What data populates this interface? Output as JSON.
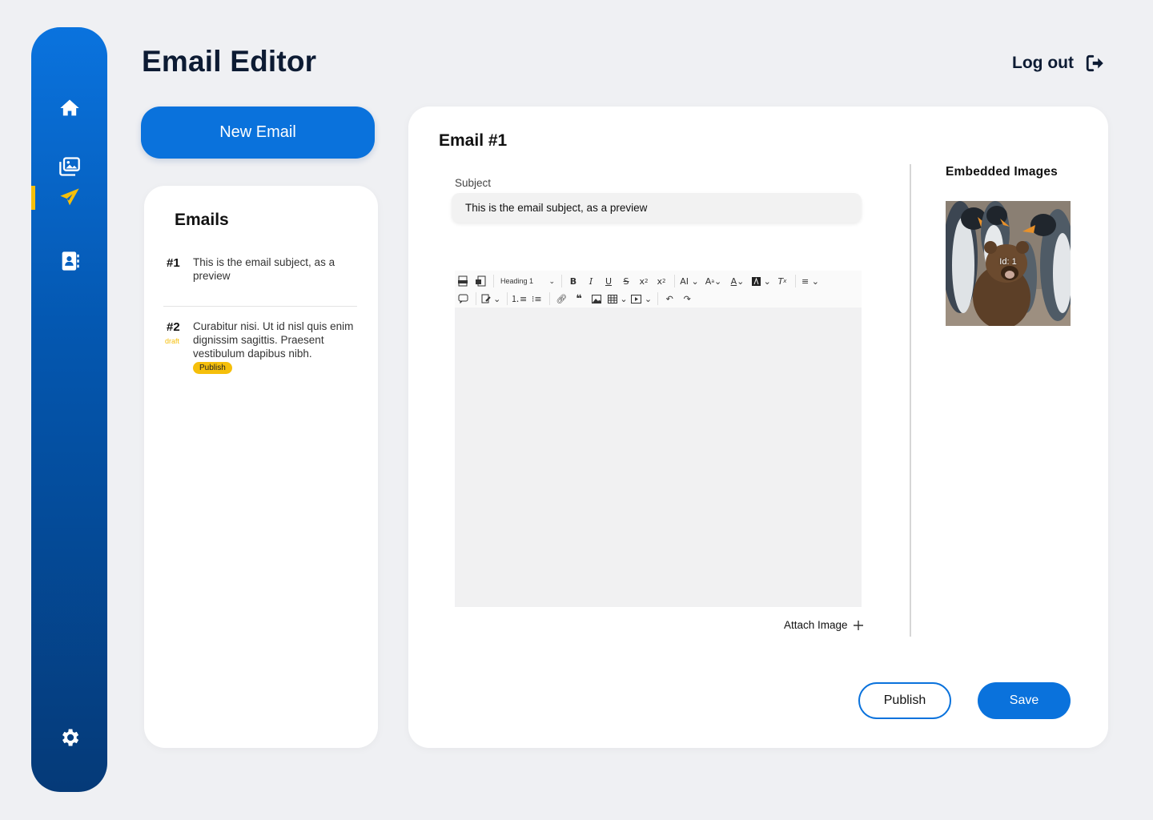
{
  "app": {
    "title": "Email Editor"
  },
  "header": {
    "logout_label": "Log out"
  },
  "sidebar": {
    "items": [
      {
        "name": "home",
        "icon": "home-icon"
      },
      {
        "name": "images",
        "icon": "images-icon"
      },
      {
        "name": "emails",
        "icon": "paper-plane-icon",
        "active": true
      },
      {
        "name": "contacts",
        "icon": "contact-book-icon"
      },
      {
        "name": "settings",
        "icon": "gear-icon"
      }
    ],
    "active_color": "#f5bf0b"
  },
  "new_email_label": "New Email",
  "emails_panel": {
    "title": "Emails",
    "items": [
      {
        "number": "#1",
        "subject": "This is the email subject, as a preview",
        "draft": "",
        "action": ""
      },
      {
        "number": "#2",
        "subject": "Curabitur nisi. Ut id nisl quis enim dignissim sagittis. Praesent vestibulum dapibus nibh.",
        "draft": "draft",
        "action": "Publish"
      }
    ]
  },
  "editor": {
    "title": "Email #1",
    "subject_label": "Subject",
    "subject_value": "This is the email subject, as a preview",
    "toolbar": {
      "heading_select": "Heading 1"
    },
    "attach_label": "Attach Image",
    "embedded_title": "Embedded Images",
    "embedded_images": [
      {
        "id_label": "Id: 1"
      }
    ],
    "publish_label": "Publish",
    "save_label": "Save"
  },
  "colors": {
    "primary": "#0a72dc",
    "accent": "#f5bf0b",
    "text": "#0d1b33"
  }
}
